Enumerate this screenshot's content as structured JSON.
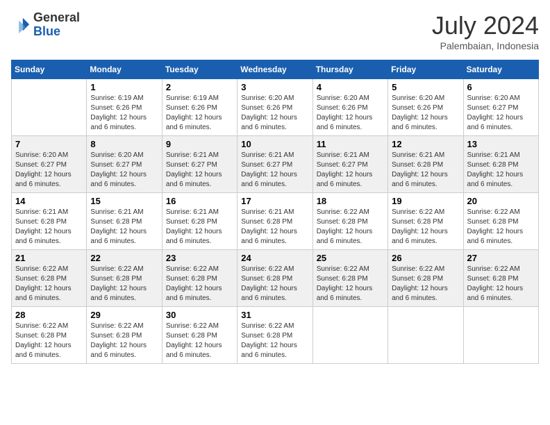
{
  "logo": {
    "general": "General",
    "blue": "Blue"
  },
  "title": "July 2024",
  "location": "Palembaian, Indonesia",
  "days_of_week": [
    "Sunday",
    "Monday",
    "Tuesday",
    "Wednesday",
    "Thursday",
    "Friday",
    "Saturday"
  ],
  "weeks": [
    [
      {
        "day": "",
        "sunrise": "",
        "sunset": "",
        "daylight": ""
      },
      {
        "day": "1",
        "sunrise": "Sunrise: 6:19 AM",
        "sunset": "Sunset: 6:26 PM",
        "daylight": "Daylight: 12 hours and 6 minutes."
      },
      {
        "day": "2",
        "sunrise": "Sunrise: 6:19 AM",
        "sunset": "Sunset: 6:26 PM",
        "daylight": "Daylight: 12 hours and 6 minutes."
      },
      {
        "day": "3",
        "sunrise": "Sunrise: 6:20 AM",
        "sunset": "Sunset: 6:26 PM",
        "daylight": "Daylight: 12 hours and 6 minutes."
      },
      {
        "day": "4",
        "sunrise": "Sunrise: 6:20 AM",
        "sunset": "Sunset: 6:26 PM",
        "daylight": "Daylight: 12 hours and 6 minutes."
      },
      {
        "day": "5",
        "sunrise": "Sunrise: 6:20 AM",
        "sunset": "Sunset: 6:26 PM",
        "daylight": "Daylight: 12 hours and 6 minutes."
      },
      {
        "day": "6",
        "sunrise": "Sunrise: 6:20 AM",
        "sunset": "Sunset: 6:27 PM",
        "daylight": "Daylight: 12 hours and 6 minutes."
      }
    ],
    [
      {
        "day": "7",
        "sunrise": "Sunrise: 6:20 AM",
        "sunset": "Sunset: 6:27 PM",
        "daylight": "Daylight: 12 hours and 6 minutes."
      },
      {
        "day": "8",
        "sunrise": "Sunrise: 6:20 AM",
        "sunset": "Sunset: 6:27 PM",
        "daylight": "Daylight: 12 hours and 6 minutes."
      },
      {
        "day": "9",
        "sunrise": "Sunrise: 6:21 AM",
        "sunset": "Sunset: 6:27 PM",
        "daylight": "Daylight: 12 hours and 6 minutes."
      },
      {
        "day": "10",
        "sunrise": "Sunrise: 6:21 AM",
        "sunset": "Sunset: 6:27 PM",
        "daylight": "Daylight: 12 hours and 6 minutes."
      },
      {
        "day": "11",
        "sunrise": "Sunrise: 6:21 AM",
        "sunset": "Sunset: 6:27 PM",
        "daylight": "Daylight: 12 hours and 6 minutes."
      },
      {
        "day": "12",
        "sunrise": "Sunrise: 6:21 AM",
        "sunset": "Sunset: 6:28 PM",
        "daylight": "Daylight: 12 hours and 6 minutes."
      },
      {
        "day": "13",
        "sunrise": "Sunrise: 6:21 AM",
        "sunset": "Sunset: 6:28 PM",
        "daylight": "Daylight: 12 hours and 6 minutes."
      }
    ],
    [
      {
        "day": "14",
        "sunrise": "Sunrise: 6:21 AM",
        "sunset": "Sunset: 6:28 PM",
        "daylight": "Daylight: 12 hours and 6 minutes."
      },
      {
        "day": "15",
        "sunrise": "Sunrise: 6:21 AM",
        "sunset": "Sunset: 6:28 PM",
        "daylight": "Daylight: 12 hours and 6 minutes."
      },
      {
        "day": "16",
        "sunrise": "Sunrise: 6:21 AM",
        "sunset": "Sunset: 6:28 PM",
        "daylight": "Daylight: 12 hours and 6 minutes."
      },
      {
        "day": "17",
        "sunrise": "Sunrise: 6:21 AM",
        "sunset": "Sunset: 6:28 PM",
        "daylight": "Daylight: 12 hours and 6 minutes."
      },
      {
        "day": "18",
        "sunrise": "Sunrise: 6:22 AM",
        "sunset": "Sunset: 6:28 PM",
        "daylight": "Daylight: 12 hours and 6 minutes."
      },
      {
        "day": "19",
        "sunrise": "Sunrise: 6:22 AM",
        "sunset": "Sunset: 6:28 PM",
        "daylight": "Daylight: 12 hours and 6 minutes."
      },
      {
        "day": "20",
        "sunrise": "Sunrise: 6:22 AM",
        "sunset": "Sunset: 6:28 PM",
        "daylight": "Daylight: 12 hours and 6 minutes."
      }
    ],
    [
      {
        "day": "21",
        "sunrise": "Sunrise: 6:22 AM",
        "sunset": "Sunset: 6:28 PM",
        "daylight": "Daylight: 12 hours and 6 minutes."
      },
      {
        "day": "22",
        "sunrise": "Sunrise: 6:22 AM",
        "sunset": "Sunset: 6:28 PM",
        "daylight": "Daylight: 12 hours and 6 minutes."
      },
      {
        "day": "23",
        "sunrise": "Sunrise: 6:22 AM",
        "sunset": "Sunset: 6:28 PM",
        "daylight": "Daylight: 12 hours and 6 minutes."
      },
      {
        "day": "24",
        "sunrise": "Sunrise: 6:22 AM",
        "sunset": "Sunset: 6:28 PM",
        "daylight": "Daylight: 12 hours and 6 minutes."
      },
      {
        "day": "25",
        "sunrise": "Sunrise: 6:22 AM",
        "sunset": "Sunset: 6:28 PM",
        "daylight": "Daylight: 12 hours and 6 minutes."
      },
      {
        "day": "26",
        "sunrise": "Sunrise: 6:22 AM",
        "sunset": "Sunset: 6:28 PM",
        "daylight": "Daylight: 12 hours and 6 minutes."
      },
      {
        "day": "27",
        "sunrise": "Sunrise: 6:22 AM",
        "sunset": "Sunset: 6:28 PM",
        "daylight": "Daylight: 12 hours and 6 minutes."
      }
    ],
    [
      {
        "day": "28",
        "sunrise": "Sunrise: 6:22 AM",
        "sunset": "Sunset: 6:28 PM",
        "daylight": "Daylight: 12 hours and 6 minutes."
      },
      {
        "day": "29",
        "sunrise": "Sunrise: 6:22 AM",
        "sunset": "Sunset: 6:28 PM",
        "daylight": "Daylight: 12 hours and 6 minutes."
      },
      {
        "day": "30",
        "sunrise": "Sunrise: 6:22 AM",
        "sunset": "Sunset: 6:28 PM",
        "daylight": "Daylight: 12 hours and 6 minutes."
      },
      {
        "day": "31",
        "sunrise": "Sunrise: 6:22 AM",
        "sunset": "Sunset: 6:28 PM",
        "daylight": "Daylight: 12 hours and 6 minutes."
      },
      {
        "day": "",
        "sunrise": "",
        "sunset": "",
        "daylight": ""
      },
      {
        "day": "",
        "sunrise": "",
        "sunset": "",
        "daylight": ""
      },
      {
        "day": "",
        "sunrise": "",
        "sunset": "",
        "daylight": ""
      }
    ]
  ]
}
